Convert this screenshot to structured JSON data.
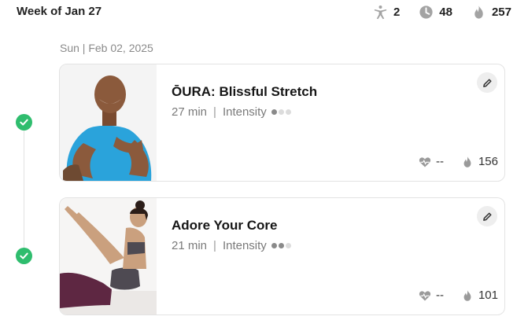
{
  "header": {
    "week_title": "Week of Jan 27",
    "stats": {
      "workouts": "2",
      "minutes": "48",
      "calories": "257"
    }
  },
  "day": {
    "date_label": "Sun | Feb 02, 2025"
  },
  "workouts": [
    {
      "title": "ŌURA: Blissful Stretch",
      "duration": "27 min",
      "intensity_label": "Intensity",
      "intensity_level": 1,
      "intensity_max": 3,
      "heart_rate": "--",
      "calories": "156",
      "completed": true
    },
    {
      "title": "Adore Your Core",
      "duration": "21 min",
      "intensity_label": "Intensity",
      "intensity_level": 2,
      "intensity_max": 3,
      "heart_rate": "--",
      "calories": "101",
      "completed": true
    }
  ],
  "colors": {
    "check_green": "#2fbd6e",
    "icon_gray": "#9a9a9a"
  },
  "icons": {
    "workouts": "person-stretch-icon",
    "minutes": "clock-icon",
    "calories": "flame-icon",
    "heart": "heart-rate-icon",
    "edit": "pencil-icon",
    "completed": "check-circle-icon"
  }
}
